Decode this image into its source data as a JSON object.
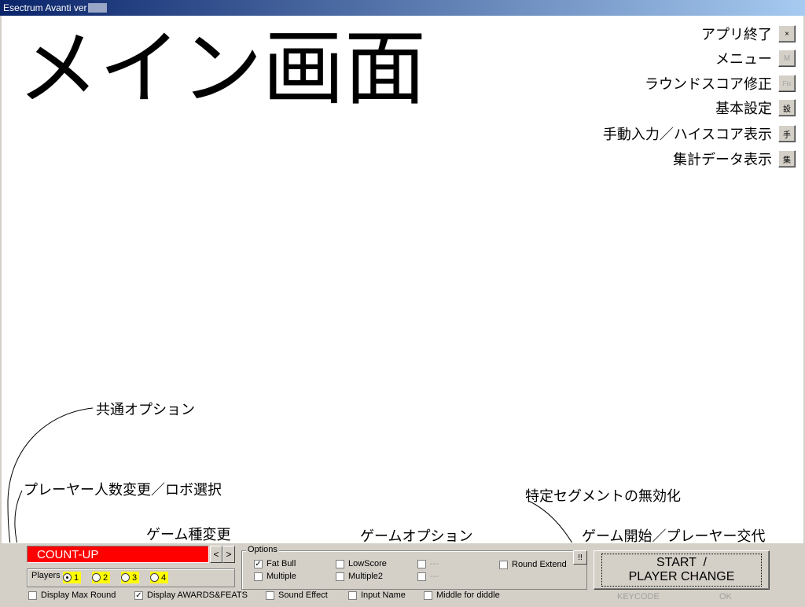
{
  "window": {
    "title": "Esectrum Avanti ver"
  },
  "screen_title": "メイン画面",
  "menu": [
    {
      "label": "アプリ終了",
      "button": "×",
      "icon": "close-icon",
      "disabled": false
    },
    {
      "label": "メニュー",
      "button": "M",
      "icon": "menu-icon",
      "disabled": true
    },
    {
      "label": "ラウンドスコア修正",
      "button": "Fix",
      "icon": "fix-icon",
      "disabled": true
    },
    {
      "label": "基本設定",
      "button": "設",
      "icon": "settings-icon",
      "disabled": false
    },
    {
      "label": "手動入力／ハイスコア表示",
      "button": "手",
      "icon": "manual-icon",
      "disabled": false
    },
    {
      "label": "集計データ表示",
      "button": "集",
      "icon": "stats-icon",
      "disabled": false
    }
  ],
  "annotations": {
    "common_options": "共通オプション",
    "players_change": "プレーヤー人数変更／ロボ選択",
    "game_type_change": "ゲーム種変更",
    "game_options": "ゲームオプション",
    "segment_disable": "特定セグメントの無効化",
    "start_change": "ゲーム開始／プレーヤー交代"
  },
  "game_type": {
    "value": "COUNT-UP",
    "prev": "<",
    "next": ">"
  },
  "players": {
    "label": "Players",
    "options": [
      "1",
      "2",
      "3",
      "4"
    ],
    "selected": "1"
  },
  "options": {
    "title": "Options",
    "items": [
      {
        "label": "Fat Bull",
        "checked": true,
        "disabled": false
      },
      {
        "label": "Multiple",
        "checked": false,
        "disabled": false
      },
      {
        "label": "LowScore",
        "checked": false,
        "disabled": false
      },
      {
        "label": "Multiple2",
        "checked": false,
        "disabled": false
      },
      {
        "label": "---",
        "checked": false,
        "disabled": true
      },
      {
        "label": "---",
        "checked": false,
        "disabled": true
      },
      {
        "label": "Round Extend",
        "checked": false,
        "disabled": false
      }
    ],
    "segment_button": "!!"
  },
  "common": [
    {
      "label": "Display Max Round",
      "checked": false
    },
    {
      "label": "Display AWARDS&FEATS",
      "checked": true
    },
    {
      "label": "Sound Effect",
      "checked": false
    },
    {
      "label": "Input Name",
      "checked": false
    },
    {
      "label": "Middle for diddle",
      "checked": false
    }
  ],
  "start_button": {
    "line1": "START  /",
    "line2": "PLAYER CHANGE"
  },
  "footer": {
    "keycode": "KEYCODE",
    "ok": "OK"
  },
  "colors": {
    "game_type_bg": "#ff0000",
    "player_highlight": "#ffff00",
    "panel": "#d4d0c8",
    "title_bar": "#0a246a"
  }
}
